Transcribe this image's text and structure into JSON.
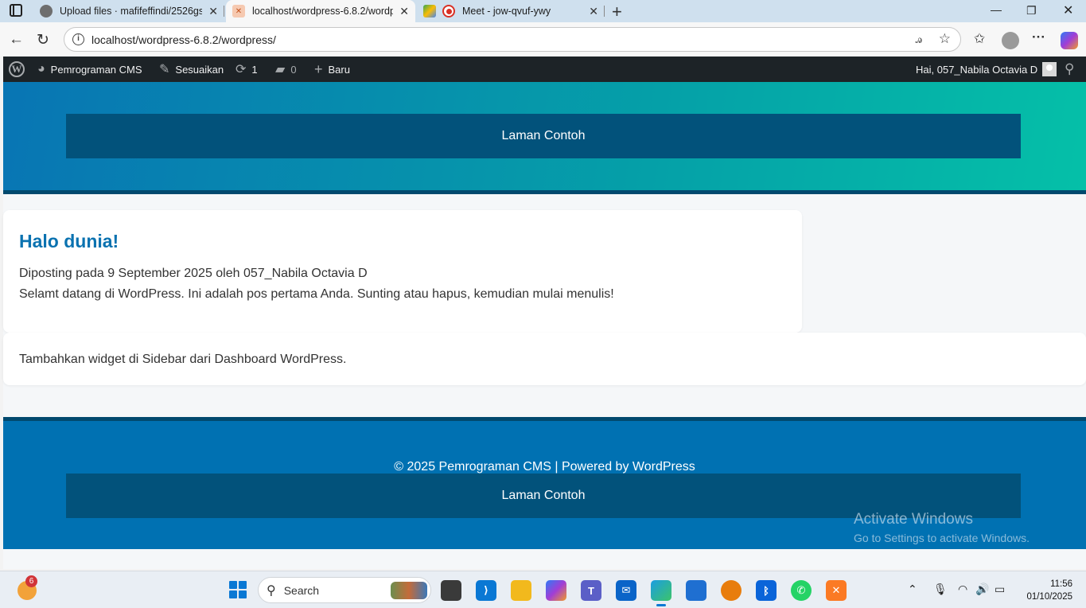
{
  "browser": {
    "tabs": [
      {
        "title": "Upload files · mafifeffindi/2526gs",
        "favicon": "github-icon",
        "active": false
      },
      {
        "title": "localhost/wordpress-6.8.2/wordpr",
        "favicon": "xampp-icon",
        "active": true
      },
      {
        "title": "Meet - jow-qvuf-ywy",
        "favicon": "google-meet-icon",
        "active": false
      }
    ],
    "url": "localhost/wordpress-6.8.2/wordpress/"
  },
  "admin_bar": {
    "site_name": "Pemrograman CMS",
    "customize": "Sesuaikan",
    "updates_count": "1",
    "comments_count": "0",
    "new_label": "Baru",
    "greeting": "Hai, 057_Nabila Octavia D"
  },
  "header": {
    "nav_link": "Laman Contoh",
    "gradient_start": "#0875b4",
    "gradient_end": "#05c0a8"
  },
  "post": {
    "title": "Halo dunia!",
    "meta": "Diposting pada 9 September 2025 oleh 057_Nabila Octavia D",
    "body": "Selamt datang di WordPress. Ini adalah pos pertama Anda. Sunting atau hapus, kemudian mulai menulis!"
  },
  "sidebar": {
    "text": "Tambahkan widget di Sidebar dari Dashboard WordPress."
  },
  "footer": {
    "copyright": "© 2025 Pemrograman CMS | Powered by WordPress",
    "nav_link": "Laman Contoh",
    "color": "#0071b2"
  },
  "watermark": {
    "line1": "Activate Windows",
    "line2": "Go to Settings to activate Windows."
  },
  "taskbar": {
    "weather_badge": "6",
    "search_placeholder": "Search",
    "time": "11:56",
    "date": "01/10/2025"
  }
}
